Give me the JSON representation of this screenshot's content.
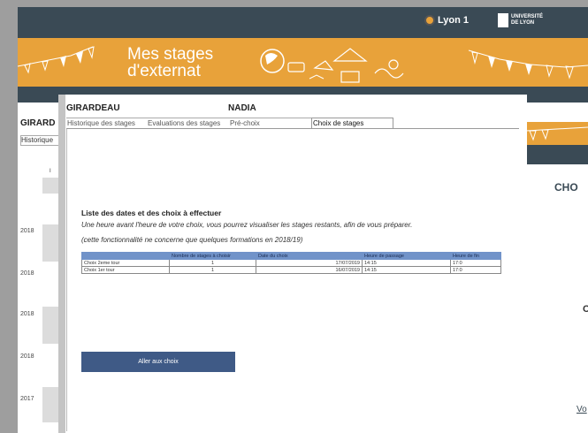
{
  "header": {
    "lyon_label": "Lyon 1",
    "univ_line1": "UNIVERSITÉ",
    "univ_line2": "DE LYON"
  },
  "banner": {
    "title_line1": "Mes stages",
    "title_line2": "d'externat"
  },
  "background": {
    "name_fragment": "GIRARD",
    "tab_fragment": "Historique",
    "years": [
      "2018",
      "2018",
      "2018",
      "2018",
      "2017"
    ],
    "small_letter": "I"
  },
  "right_panel": {
    "heading_fragment": "CHO",
    "letter": "C",
    "link_fragment": "Vo"
  },
  "student": {
    "last_name": "GIRARDEAU",
    "first_name": "NADIA"
  },
  "tabs": [
    {
      "label": "Historique des stages"
    },
    {
      "label": "Evaluations des stages"
    },
    {
      "label": "Pré-choix"
    },
    {
      "label": "Choix de stages",
      "active": true
    }
  ],
  "content": {
    "heading": "Liste des dates et des choix à effectuer",
    "info_line1": "Une heure avant l'heure de votre choix, vous pourrez visualiser les stages restants, afin de vous préparer.",
    "info_line2": "(cette fonctionnalité ne concerne que quelques formations en 2018/19)"
  },
  "table": {
    "headers": [
      "",
      "Nombre de stages à choisir",
      "Date du choix",
      "Heure de passage",
      "Heure de fin"
    ],
    "rows": [
      [
        "Choix 2eme tour",
        "1",
        "17/07/2019",
        "14:15",
        "17:0"
      ],
      [
        "Choix 1er tour",
        "1",
        "16/07/2019",
        "14:15",
        "17:0"
      ]
    ]
  },
  "actions": {
    "go_label": "Aller aux choix"
  },
  "colors": {
    "orange": "#e8a23a",
    "dark": "#3a4a55",
    "table_header": "#7193c9",
    "button": "#3f5a86"
  }
}
